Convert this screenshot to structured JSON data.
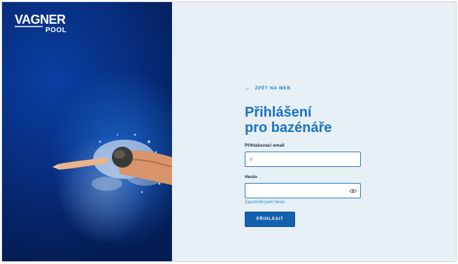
{
  "brand": {
    "logo_top": "VAGNER",
    "logo_bottom": "POOL"
  },
  "nav": {
    "back_label": "ZPĚT NA WEB",
    "back_icon": "arrow-left-icon"
  },
  "login": {
    "title_line1": "Přihlášení",
    "title_line2": "pro bazénáře",
    "email_label": "Přihlašovací email",
    "email_value": "",
    "password_label": "Heslo",
    "password_value": "",
    "forgot_label": "Zapomněl jsem heslo",
    "submit_label": "PŘIHLÁSIT"
  },
  "colors": {
    "accent": "#1a72c3",
    "button": "#1460ad",
    "panel_bg": "#e6f0f5"
  }
}
